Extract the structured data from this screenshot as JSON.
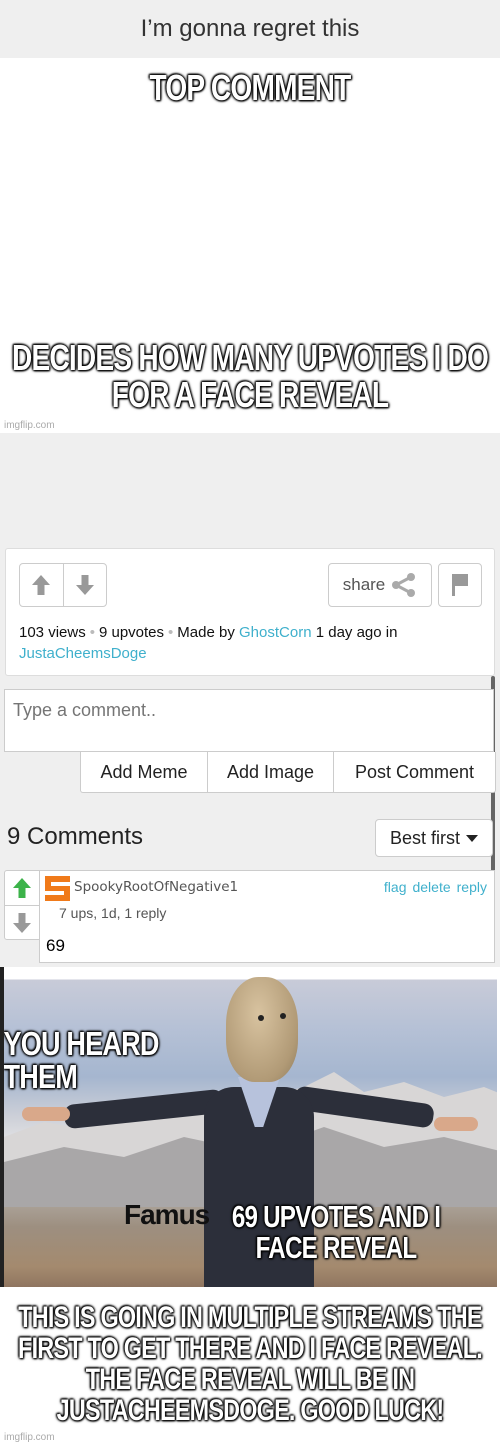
{
  "page_title": "I’m gonna regret this",
  "meme_top": {
    "top_text": "TOP COMMENT",
    "bottom_text": "DECIDES HOW MANY UPVOTES I DO FOR A FACE REVEAL",
    "watermark": "imgflip.com"
  },
  "post": {
    "upvote_icon": "arrow-up-icon",
    "downvote_icon": "arrow-down-icon",
    "share_label": "share",
    "share_icon": "share-icon",
    "flag_icon": "flag-icon",
    "views": "103 views",
    "upvotes": "9 upvotes",
    "made_by_prefix": "Made by",
    "author": "GhostCorn",
    "time_suffix": "1 day ago in",
    "stream": "JustaCheemsDoge",
    "link_color": "#3fb0cc"
  },
  "comment_box": {
    "placeholder": "Type a comment..",
    "value": "",
    "buttons": [
      "Add Meme",
      "Add Image",
      "Post Comment"
    ]
  },
  "comments_header": {
    "count_label": "9 Comments",
    "sort_selected": "Best first"
  },
  "comments": [
    {
      "username": "SpookyRootOfNegative1",
      "avatar_letter": "S",
      "avatar_color": "#f07a1a",
      "upvoted_color": "#3cb34a",
      "actions": [
        "flag",
        "delete",
        "reply"
      ],
      "meta": "7 ups, 1d, 1 reply",
      "text": "69"
    }
  ],
  "meme_reply": {
    "top_text": "YOU HEARD THEM",
    "famus_text": "Famus",
    "middle_text": "69 UPVOTES AND I FACE REVEAL",
    "bottom_text": "THIS IS GOING IN MULTIPLE STREAMS THE FIRST TO GET THERE AND I FACE REVEAL. THE FACE REVEAL WILL BE IN JUSTACHEEMSDOGE. GOOD LUCK!",
    "watermark": "imgflip.com"
  }
}
